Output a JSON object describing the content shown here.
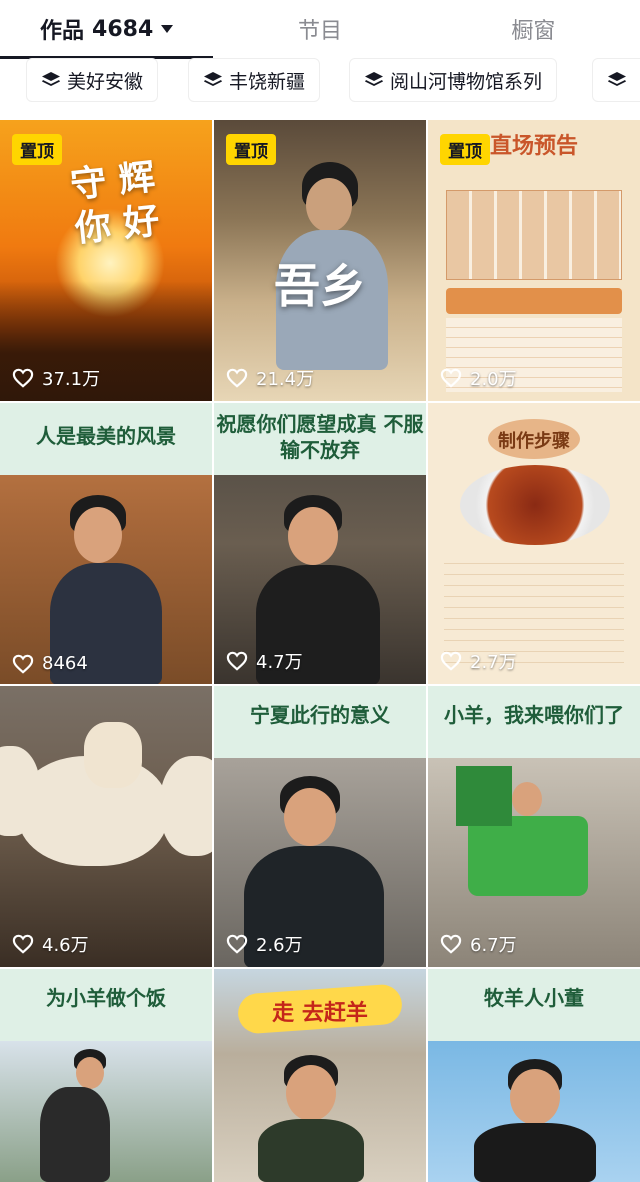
{
  "tabs": {
    "works_label": "作品",
    "works_count": "4684",
    "program_label": "节目",
    "showcase_label": "橱窗"
  },
  "collections": [
    {
      "label": "美好安徽",
      "icon": "stack-icon"
    },
    {
      "label": "丰饶新疆",
      "icon": "stack-icon"
    },
    {
      "label": "阅山河博物馆系列",
      "icon": "stack-icon"
    },
    {
      "label": "",
      "icon": "stack-icon"
    }
  ],
  "pin_label": "置顶",
  "videos": [
    {
      "title": "守 辉 你 好",
      "likes": "37.1万",
      "pinned": true
    },
    {
      "title": "吾乡",
      "likes": "21.4万",
      "pinned": true
    },
    {
      "title": "直场预告",
      "likes": "2.0万",
      "pinned": true
    },
    {
      "title": "人是最美的风景",
      "likes": "8464",
      "pinned": false
    },
    {
      "title": "祝愿你们愿望成真 不服输不放弃",
      "likes": "4.7万",
      "pinned": false
    },
    {
      "title": "制作步骤",
      "likes": "2.7万",
      "pinned": false
    },
    {
      "title": "",
      "likes": "4.6万",
      "pinned": false
    },
    {
      "title": "宁夏此行的意义",
      "likes": "2.6万",
      "pinned": false
    },
    {
      "title": "小羊，我来喂你们了",
      "likes": "6.7万",
      "pinned": false
    },
    {
      "title": "为小羊做个饭",
      "likes": "",
      "pinned": false
    },
    {
      "title": "走 去赶羊",
      "likes": "",
      "pinned": false
    },
    {
      "title": "牧羊人小董",
      "likes": "",
      "pinned": false
    }
  ],
  "colors": {
    "pin_bg": "#ffd500",
    "active_tab": "#161823",
    "inactive_tab": "#8a8b91"
  }
}
